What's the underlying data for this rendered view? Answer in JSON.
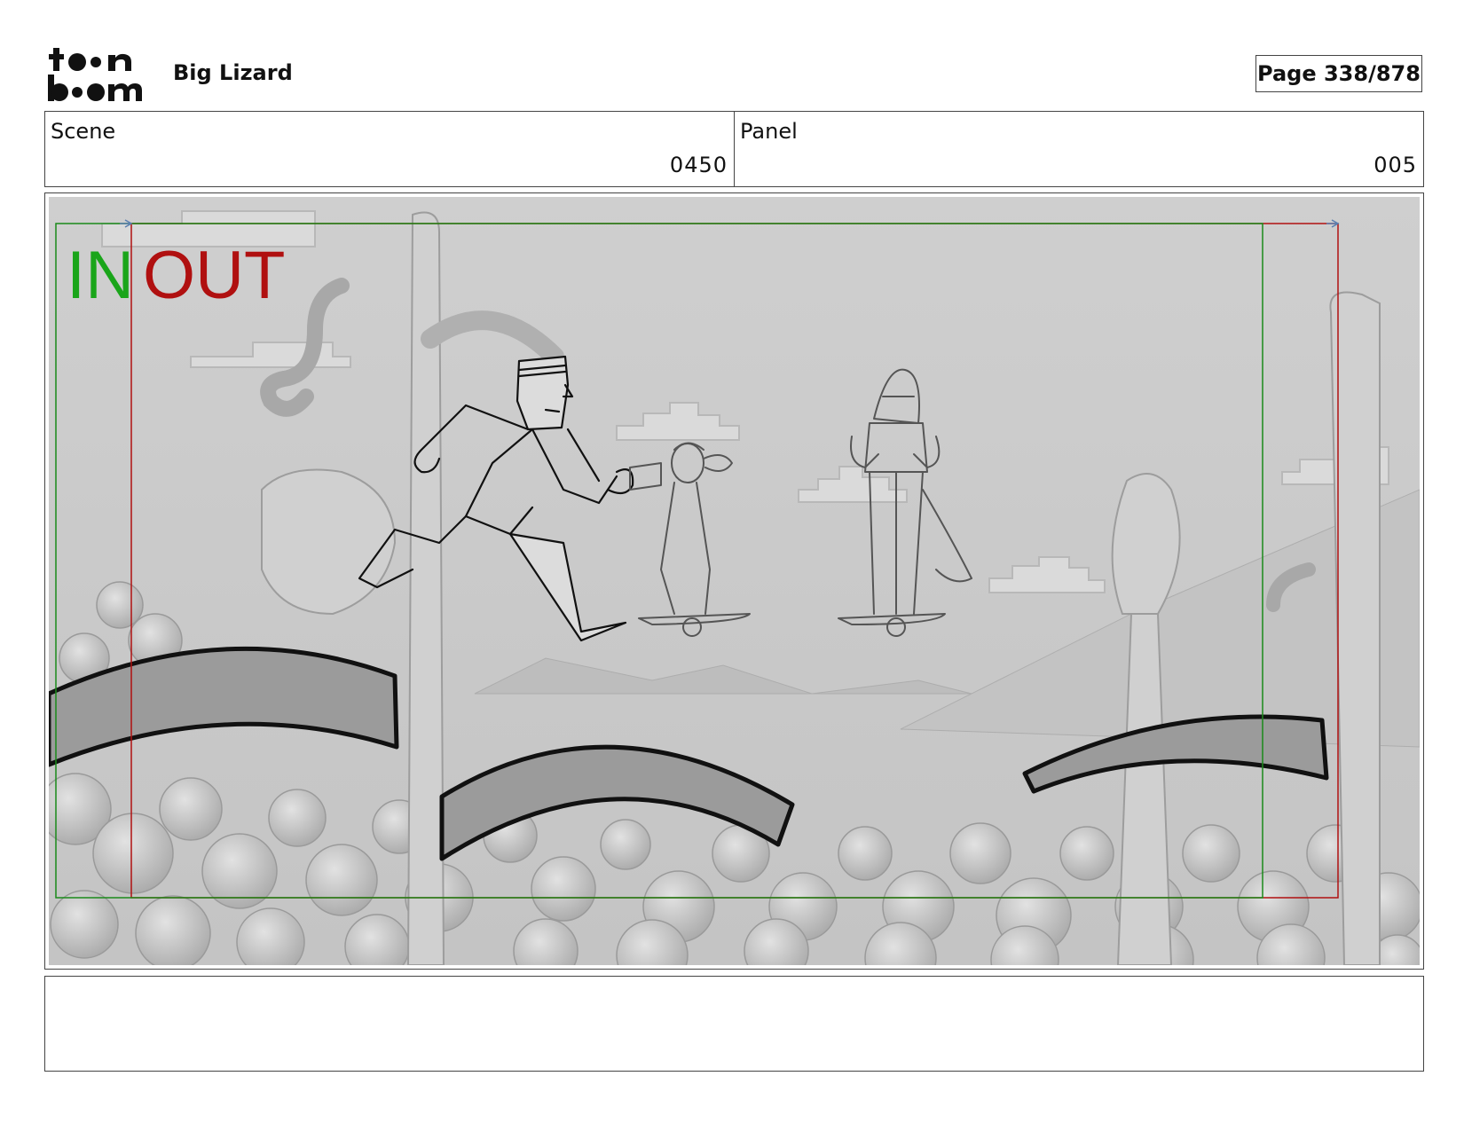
{
  "header": {
    "logo_alt": "toon boom",
    "project_title": "Big Lizard",
    "page_indicator": "Page 338/878"
  },
  "info": {
    "scene_label": "Scene",
    "scene_value": "0450",
    "panel_label": "Panel",
    "panel_value": "005"
  },
  "frame": {
    "in_label": "IN",
    "out_label": "OUT",
    "in_color": "#1aa51a",
    "out_color": "#b01010"
  },
  "notes": {
    "text": ""
  }
}
